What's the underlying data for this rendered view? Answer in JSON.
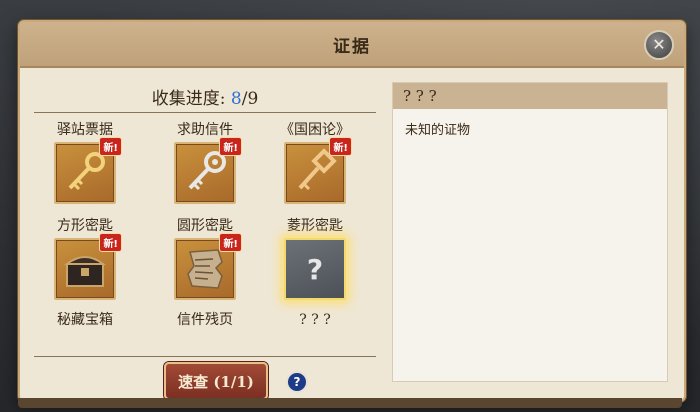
{
  "dialog": {
    "title": "证据"
  },
  "progress": {
    "label": "收集进度:",
    "current": "8",
    "separator": "/",
    "total": "9"
  },
  "items": [
    {
      "label": "驿站票据",
      "badge": "新!",
      "icon": "gold-key-icon"
    },
    {
      "label": "求助信件",
      "badge": "新!",
      "icon": "silver-key-icon"
    },
    {
      "label": "《国困论》",
      "badge": "新!",
      "icon": "bronze-key-icon"
    },
    {
      "label": "方形密匙",
      "badge": "新!",
      "icon": "treasure-chest-icon"
    },
    {
      "label": "圆形密匙",
      "badge": "新!",
      "icon": "torn-letter-icon"
    },
    {
      "label": "菱形密匙",
      "badge": "",
      "icon": "question-mark-icon"
    },
    {
      "label": "秘藏宝箱"
    },
    {
      "label": "信件残页"
    },
    {
      "label": "? ? ?"
    }
  ],
  "quick_button": {
    "label": "速查 (1/1)"
  },
  "help_button": {
    "label": "?"
  },
  "detail": {
    "title": "? ? ?",
    "description": "未知的证物"
  },
  "colors": {
    "progress_number": "#2f6fd2",
    "badge": "#c8261c",
    "quick_button": "#8d3a2a"
  }
}
